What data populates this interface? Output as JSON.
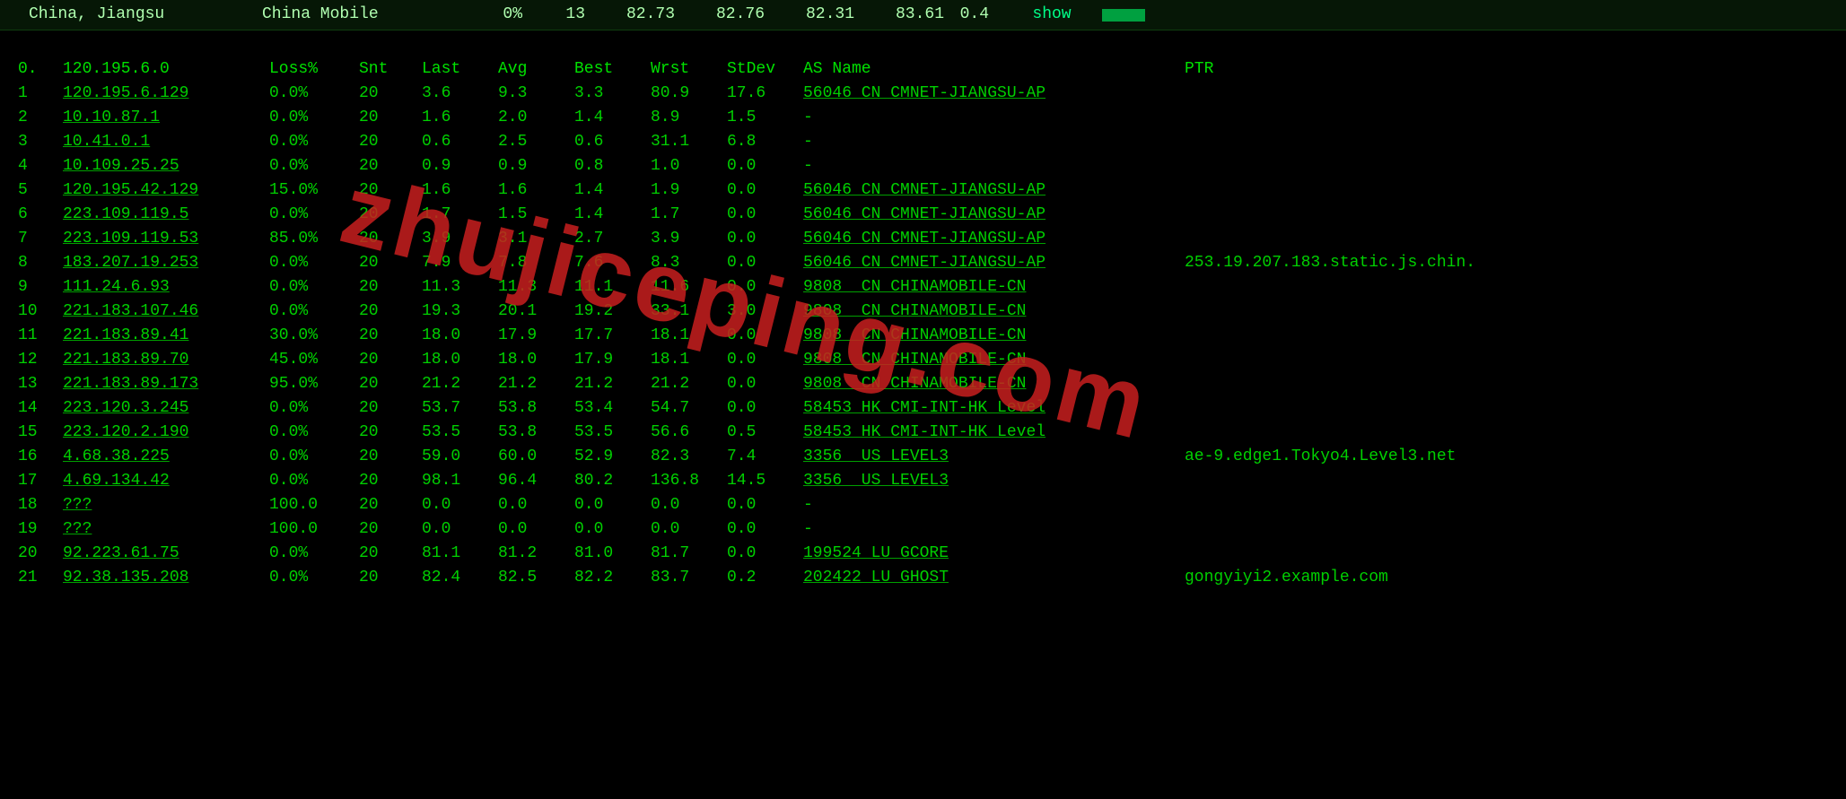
{
  "summary": {
    "location": "China, Jiangsu",
    "isp": "China Mobile",
    "loss_pct": "0%",
    "hops": "13",
    "v1": "82.73",
    "v2": "82.76",
    "v3": "82.31",
    "v4": "83.61",
    "sd": "0.4",
    "show": "show"
  },
  "headers": {
    "hop": "0.",
    "ip": "120.195.6.0",
    "loss": "Loss%",
    "snt": "Snt",
    "last": "Last",
    "avg": "Avg",
    "best": "Best",
    "wrst": "Wrst",
    "stdev": "StDev",
    "as": "AS Name",
    "ptr": "PTR"
  },
  "hops": [
    {
      "n": "1",
      "ip": "120.195.6.129",
      "loss": "0.0%",
      "snt": "20",
      "last": "3.6",
      "avg": "9.3",
      "best": "3.3",
      "wrst": "80.9",
      "stdev": "17.6",
      "as": "56046 CN CMNET-JIANGSU-AP",
      "ptr": ""
    },
    {
      "n": "2",
      "ip": "10.10.87.1",
      "loss": "0.0%",
      "snt": "20",
      "last": "1.6",
      "avg": "2.0",
      "best": "1.4",
      "wrst": "8.9",
      "stdev": "1.5",
      "as": "-",
      "ptr": ""
    },
    {
      "n": "3",
      "ip": "10.41.0.1",
      "loss": "0.0%",
      "snt": "20",
      "last": "0.6",
      "avg": "2.5",
      "best": "0.6",
      "wrst": "31.1",
      "stdev": "6.8",
      "as": "-",
      "ptr": ""
    },
    {
      "n": "4",
      "ip": "10.109.25.25",
      "loss": "0.0%",
      "snt": "20",
      "last": "0.9",
      "avg": "0.9",
      "best": "0.8",
      "wrst": "1.0",
      "stdev": "0.0",
      "as": "-",
      "ptr": ""
    },
    {
      "n": "5",
      "ip": "120.195.42.129",
      "loss": "15.0%",
      "snt": "20",
      "last": "1.6",
      "avg": "1.6",
      "best": "1.4",
      "wrst": "1.9",
      "stdev": "0.0",
      "as": "56046 CN CMNET-JIANGSU-AP",
      "ptr": ""
    },
    {
      "n": "6",
      "ip": "223.109.119.5",
      "loss": "0.0%",
      "snt": "20",
      "last": "1.7",
      "avg": "1.5",
      "best": "1.4",
      "wrst": "1.7",
      "stdev": "0.0",
      "as": "56046 CN CMNET-JIANGSU-AP",
      "ptr": ""
    },
    {
      "n": "7",
      "ip": "223.109.119.53",
      "loss": "85.0%",
      "snt": "20",
      "last": "3.9",
      "avg": "3.1",
      "best": "2.7",
      "wrst": "3.9",
      "stdev": "0.0",
      "as": "56046 CN CMNET-JIANGSU-AP",
      "ptr": ""
    },
    {
      "n": "8",
      "ip": "183.207.19.253",
      "loss": "0.0%",
      "snt": "20",
      "last": "7.9",
      "avg": "7.8",
      "best": "7.6",
      "wrst": "8.3",
      "stdev": "0.0",
      "as": "56046 CN CMNET-JIANGSU-AP",
      "ptr": "253.19.207.183.static.js.chin."
    },
    {
      "n": "9",
      "ip": "111.24.6.93",
      "loss": "0.0%",
      "snt": "20",
      "last": "11.3",
      "avg": "11.3",
      "best": "11.1",
      "wrst": "11.6",
      "stdev": "0.0",
      "as": "9808  CN CHINAMOBILE-CN",
      "ptr": ""
    },
    {
      "n": "10",
      "ip": "221.183.107.46",
      "loss": "0.0%",
      "snt": "20",
      "last": "19.3",
      "avg": "20.1",
      "best": "19.2",
      "wrst": "33.1",
      "stdev": "3.0",
      "as": "9808  CN CHINAMOBILE-CN",
      "ptr": ""
    },
    {
      "n": "11",
      "ip": "221.183.89.41",
      "loss": "30.0%",
      "snt": "20",
      "last": "18.0",
      "avg": "17.9",
      "best": "17.7",
      "wrst": "18.1",
      "stdev": "0.0",
      "as": "9808  CN CHINAMOBILE-CN",
      "ptr": ""
    },
    {
      "n": "12",
      "ip": "221.183.89.70",
      "loss": "45.0%",
      "snt": "20",
      "last": "18.0",
      "avg": "18.0",
      "best": "17.9",
      "wrst": "18.1",
      "stdev": "0.0",
      "as": "9808  CN CHINAMOBILE-CN",
      "ptr": ""
    },
    {
      "n": "13",
      "ip": "221.183.89.173",
      "loss": "95.0%",
      "snt": "20",
      "last": "21.2",
      "avg": "21.2",
      "best": "21.2",
      "wrst": "21.2",
      "stdev": "0.0",
      "as": "9808  CN CHINAMOBILE-CN",
      "ptr": ""
    },
    {
      "n": "14",
      "ip": "223.120.3.245",
      "loss": "0.0%",
      "snt": "20",
      "last": "53.7",
      "avg": "53.8",
      "best": "53.4",
      "wrst": "54.7",
      "stdev": "0.0",
      "as": "58453 HK CMI-INT-HK Level",
      "ptr": ""
    },
    {
      "n": "15",
      "ip": "223.120.2.190",
      "loss": "0.0%",
      "snt": "20",
      "last": "53.5",
      "avg": "53.8",
      "best": "53.5",
      "wrst": "56.6",
      "stdev": "0.5",
      "as": "58453 HK CMI-INT-HK Level",
      "ptr": ""
    },
    {
      "n": "16",
      "ip": "4.68.38.225",
      "loss": "0.0%",
      "snt": "20",
      "last": "59.0",
      "avg": "60.0",
      "best": "52.9",
      "wrst": "82.3",
      "stdev": "7.4",
      "as": "3356  US LEVEL3",
      "ptr": "ae-9.edge1.Tokyo4.Level3.net"
    },
    {
      "n": "17",
      "ip": "4.69.134.42",
      "loss": "0.0%",
      "snt": "20",
      "last": "98.1",
      "avg": "96.4",
      "best": "80.2",
      "wrst": "136.8",
      "stdev": "14.5",
      "as": "3356  US LEVEL3",
      "ptr": ""
    },
    {
      "n": "18",
      "ip": "???",
      "loss": "100.0",
      "snt": "20",
      "last": "0.0",
      "avg": "0.0",
      "best": "0.0",
      "wrst": "0.0",
      "stdev": "0.0",
      "as": "-",
      "ptr": ""
    },
    {
      "n": "19",
      "ip": "???",
      "loss": "100.0",
      "snt": "20",
      "last": "0.0",
      "avg": "0.0",
      "best": "0.0",
      "wrst": "0.0",
      "stdev": "0.0",
      "as": "-",
      "ptr": ""
    },
    {
      "n": "20",
      "ip": "92.223.61.75",
      "loss": "0.0%",
      "snt": "20",
      "last": "81.1",
      "avg": "81.2",
      "best": "81.0",
      "wrst": "81.7",
      "stdev": "0.0",
      "as": "199524 LU GCORE",
      "ptr": ""
    },
    {
      "n": "21",
      "ip": "92.38.135.208",
      "loss": "0.0%",
      "snt": "20",
      "last": "82.4",
      "avg": "82.5",
      "best": "82.2",
      "wrst": "83.7",
      "stdev": "0.2",
      "as": "202422 LU GHOST",
      "ptr": "gongyiyi2.example.com"
    }
  ],
  "watermark": "zhujiceping.com"
}
